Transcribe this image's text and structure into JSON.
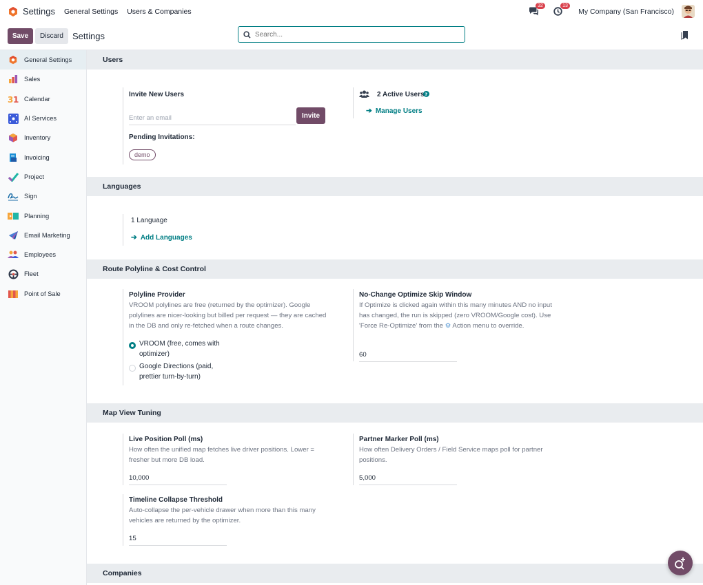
{
  "navbar": {
    "app_name": "Settings",
    "menus": [
      "General Settings",
      "Users & Companies"
    ],
    "messages_count": "32",
    "activities_count": "13",
    "company": "My Company (San Francisco)"
  },
  "control": {
    "save_label": "Save",
    "discard_label": "Discard",
    "breadcrumb": "Settings",
    "search_placeholder": "Search..."
  },
  "sidebar": {
    "items": [
      {
        "label": "General Settings",
        "icon": "settings-icon",
        "active": true
      },
      {
        "label": "Sales",
        "icon": "sales-icon"
      },
      {
        "label": "Calendar",
        "icon": "calendar-icon"
      },
      {
        "label": "AI Services",
        "icon": "ai-services-icon"
      },
      {
        "label": "Inventory",
        "icon": "inventory-icon"
      },
      {
        "label": "Invoicing",
        "icon": "invoicing-icon"
      },
      {
        "label": "Project",
        "icon": "project-icon"
      },
      {
        "label": "Sign",
        "icon": "sign-icon"
      },
      {
        "label": "Planning",
        "icon": "planning-icon"
      },
      {
        "label": "Email Marketing",
        "icon": "email-marketing-icon"
      },
      {
        "label": "Employees",
        "icon": "employees-icon"
      },
      {
        "label": "Fleet",
        "icon": "fleet-icon"
      },
      {
        "label": "Point of Sale",
        "icon": "point-of-sale-icon"
      }
    ]
  },
  "users": {
    "title": "Users",
    "invite_label": "Invite New Users",
    "email_placeholder": "Enter an email",
    "invite_button": "Invite",
    "pending_label": "Pending Invitations:",
    "pending_tag": "demo",
    "active_users": "2 Active Users",
    "manage_users": "Manage Users"
  },
  "languages": {
    "title": "Languages",
    "count": "1 Language",
    "add_link": "Add Languages"
  },
  "route": {
    "title": "Route Polyline & Cost Control",
    "provider_label": "Polyline Provider",
    "provider_desc": "VROOM polylines are free (returned by the optimizer). Google polylines are nicer-looking but billed per request — they are cached in the DB and only re-fetched when a route changes.",
    "option1": "VROOM (free, comes with optimizer)",
    "option2": "Google Directions (paid, prettier turn-by-turn)",
    "selected_option": "VROOM (free, comes with optimizer)",
    "skip_label": "No-Change Optimize Skip Window",
    "skip_desc_1": "If Optimize is clicked again within this many minutes AND no input has changed, the run is skipped (zero VROOM/Google cost). Use 'Force Re-Optimize' from the ",
    "skip_desc_2": " Action menu to override.",
    "skip_value": "60"
  },
  "map": {
    "title": "Map View Tuning",
    "live_label": "Live Position Poll (ms)",
    "live_desc": "How often the unified map fetches live driver positions. Lower = fresher but more DB load.",
    "live_value": "10,000",
    "partner_label": "Partner Marker Poll (ms)",
    "partner_desc": "How often Delivery Orders / Field Service maps poll for partner positions.",
    "partner_value": "5,000",
    "timeline_label": "Timeline Collapse Threshold",
    "timeline_desc": "Auto-collapse the per-vehicle drawer when more than this many vehicles are returned by the optimizer.",
    "timeline_value": "15"
  },
  "companies": {
    "title": "Companies"
  },
  "colors": {
    "brand": "#714b67",
    "accent": "#017e84",
    "badge": "#d9414c"
  }
}
